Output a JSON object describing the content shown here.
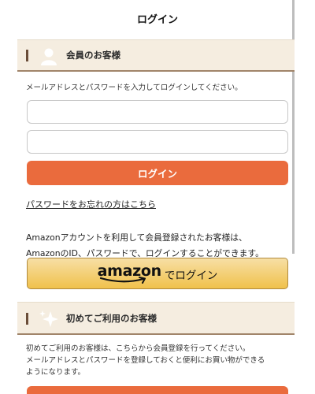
{
  "page": {
    "title": "ログイン"
  },
  "member_section": {
    "header": "会員のお客様",
    "description": "メールアドレスとパスワードを入力してログインしてください。",
    "email_value": "",
    "password_value": "",
    "login_button": "ログイン",
    "forgot_link": "パスワードをお忘れの方はこちら",
    "amazon_line1": "Amazonアカウントを利用して会員登録されたお客様は、",
    "amazon_line2": "AmazonのID、パスワードで、ログインすることができます。",
    "amazon_logo_text": "amazon",
    "amazon_button_suffix": "でログイン"
  },
  "first_time_section": {
    "header": "初めてご利用のお客様",
    "description_line1": "初めてご利用のお客様は、こちらから会員登録を行ってください。",
    "description_line2": "メールアドレスとパスワードを登録しておくと便利にお買い物ができる",
    "description_line3": "ようになります。"
  },
  "icons": {
    "member": "user-silhouette-icon",
    "first_time": "sparkle-icon",
    "amazon_smile": "amazon-smile-icon"
  },
  "colors": {
    "accent_button": "#ea6b3d",
    "section_background": "#f5ede0",
    "section_underline": "#a1856a",
    "amazon_button": "#f0c14b"
  }
}
